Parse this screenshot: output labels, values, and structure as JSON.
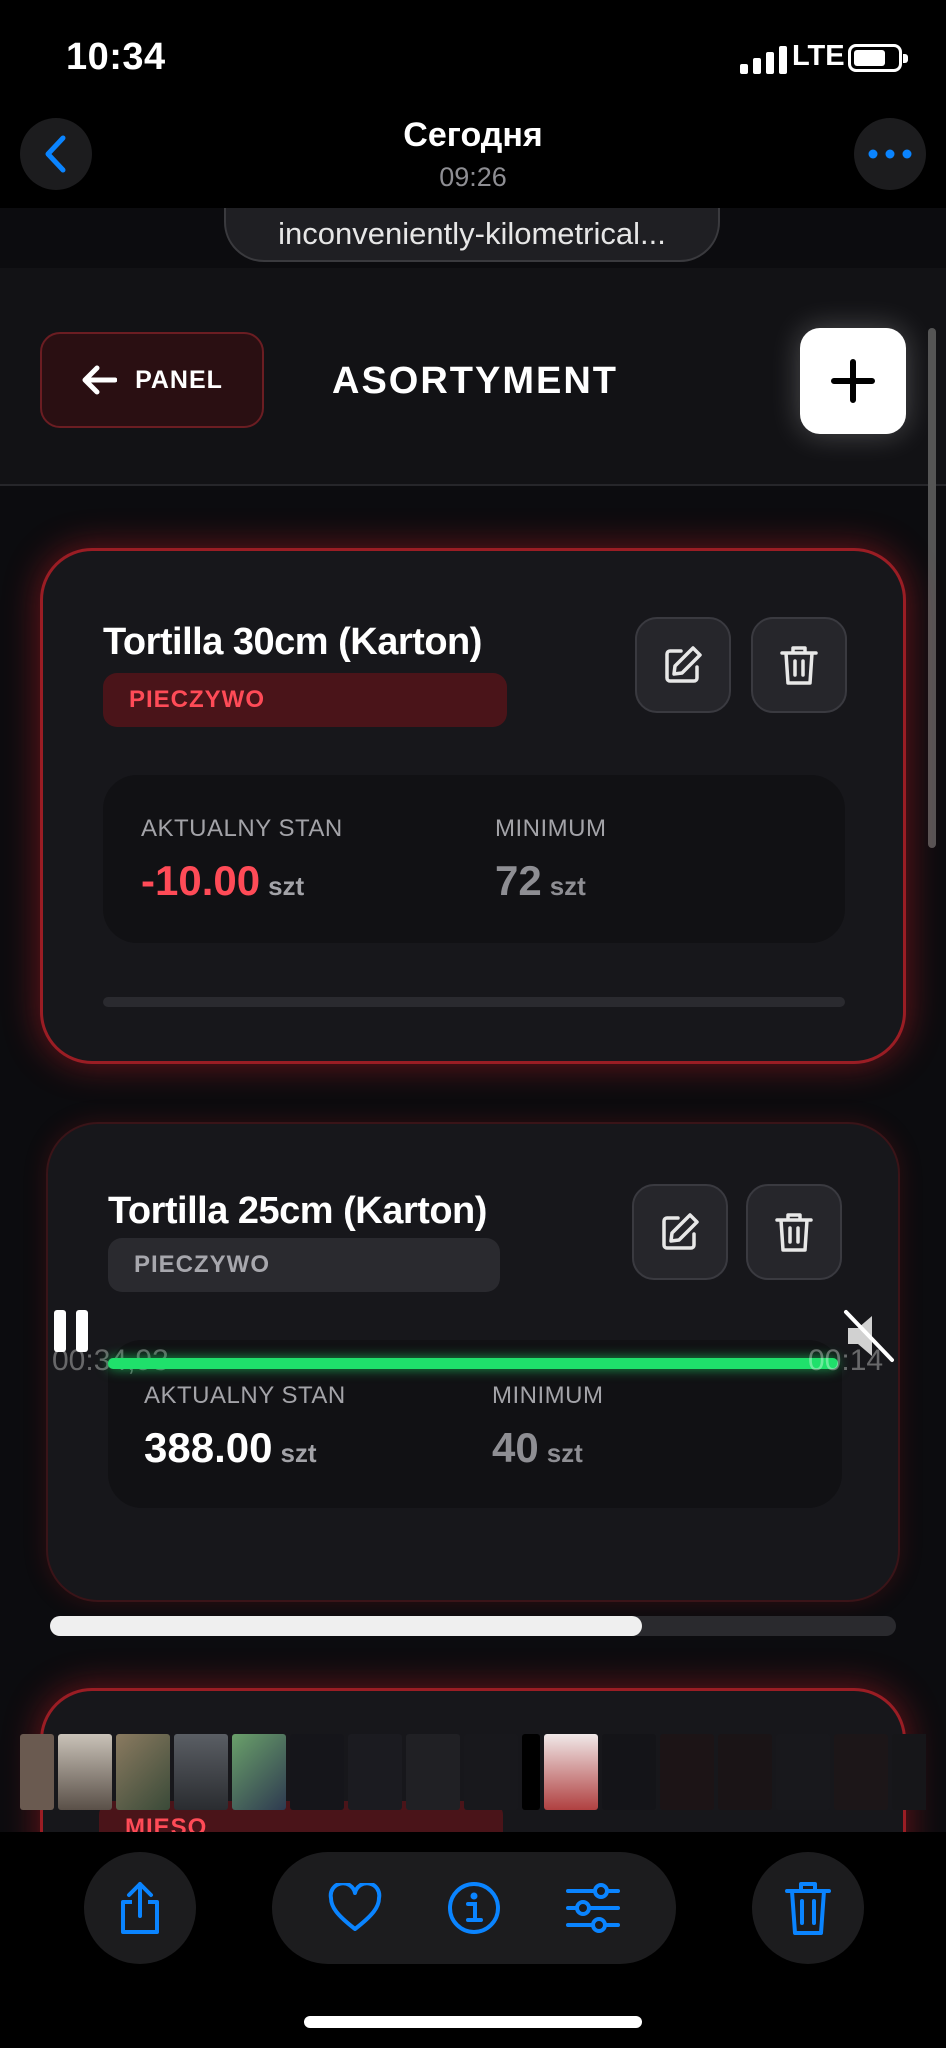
{
  "status_bar": {
    "time": "10:34",
    "network": "LTE",
    "battery_level": 0.7
  },
  "viewer": {
    "title": "Сегодня",
    "subtitle": "09:26",
    "back_icon": "chevron-left-icon",
    "more_icon": "ellipsis-icon"
  },
  "browser": {
    "url": "inconveniently-kilometrical..."
  },
  "app": {
    "back_label": "PANEL",
    "title": "ASORTYMENT",
    "add_icon": "plus-icon"
  },
  "products": [
    {
      "name": "Tortilla 30cm (Karton)",
      "category": "PIECZYWO",
      "stock_label": "AKTUALNY STAN",
      "stock_value": "-10.00",
      "stock_unit": "szt",
      "min_label": "MINIMUM",
      "min_value": "72",
      "min_unit": "szt",
      "alert": true,
      "stock_level": 0
    },
    {
      "name": "Tortilla 25cm (Karton)",
      "category": "PIECZYWO",
      "stock_label": "AKTUALNY STAN",
      "stock_value": "388.00",
      "stock_unit": "szt",
      "min_label": "MINIMUM",
      "min_value": "40",
      "min_unit": "szt",
      "alert": false
    },
    {
      "category": "MIĘSO"
    }
  ],
  "video": {
    "elapsed": "00:34,93",
    "remaining": "00:14",
    "progress": 0.7
  },
  "colors": {
    "alert_red": "#ff4b57",
    "accent_green": "#1fe06b",
    "ios_blue": "#0a84ff"
  },
  "toolbar": {
    "share_icon": "share-icon",
    "favorite_icon": "heart-icon",
    "info_icon": "info-icon",
    "adjust_icon": "sliders-icon",
    "delete_icon": "trash-icon"
  }
}
